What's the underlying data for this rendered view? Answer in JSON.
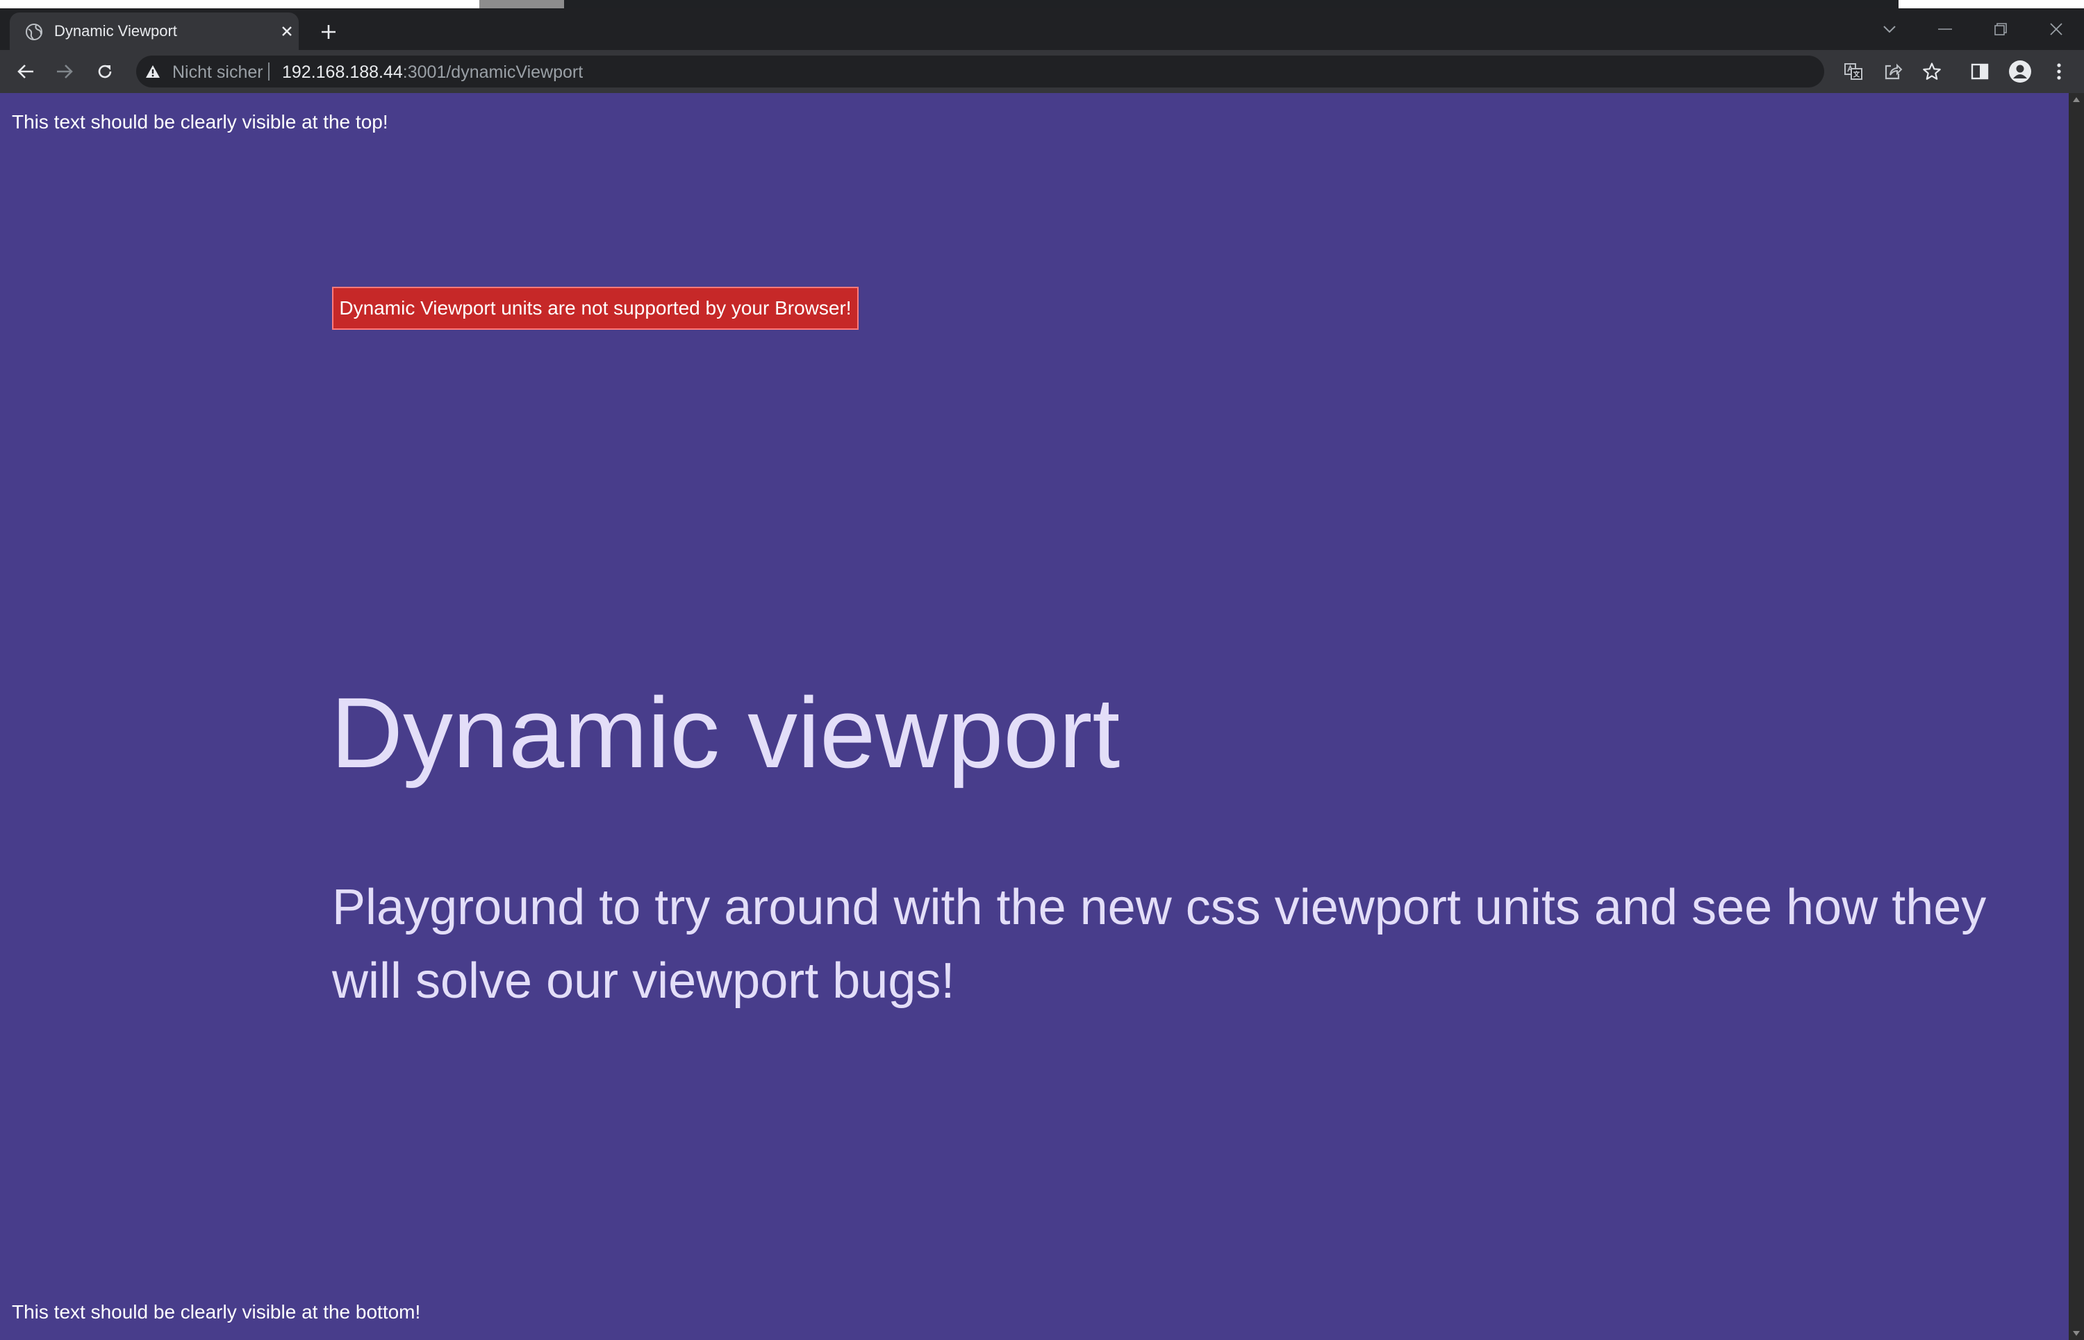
{
  "browser": {
    "tab": {
      "title": "Dynamic Viewport"
    },
    "omnibox": {
      "security_label": "Nicht sicher",
      "url_host": "192.168.188.44",
      "url_path": ":3001/dynamicViewport"
    },
    "icons": [
      "globe-icon",
      "close-icon",
      "plus-icon",
      "chevron-down-icon",
      "minimize-icon",
      "restore-icon",
      "window-close-icon",
      "back-arrow-icon",
      "forward-arrow-icon",
      "reload-icon",
      "warning-icon",
      "translate-icon",
      "share-icon",
      "star-icon",
      "side-panel-icon",
      "profile-icon",
      "kebab-menu-icon"
    ],
    "colors": {
      "titlebar": "#202124",
      "toolbar": "#35363a"
    }
  },
  "page": {
    "top_text": "This text should be clearly visible at the top!",
    "warning": "Dynamic Viewport units are not supported by your Browser!",
    "title": "Dynamic viewport",
    "subtitle": "Playground to try around with the new css viewport units and see how they will solve our viewport bugs!",
    "bottom_text": "This text should be clearly visible at the bottom!",
    "colors": {
      "background": "#483d8b",
      "warning_bg": "#c62828",
      "heading": "#e3def8"
    }
  }
}
